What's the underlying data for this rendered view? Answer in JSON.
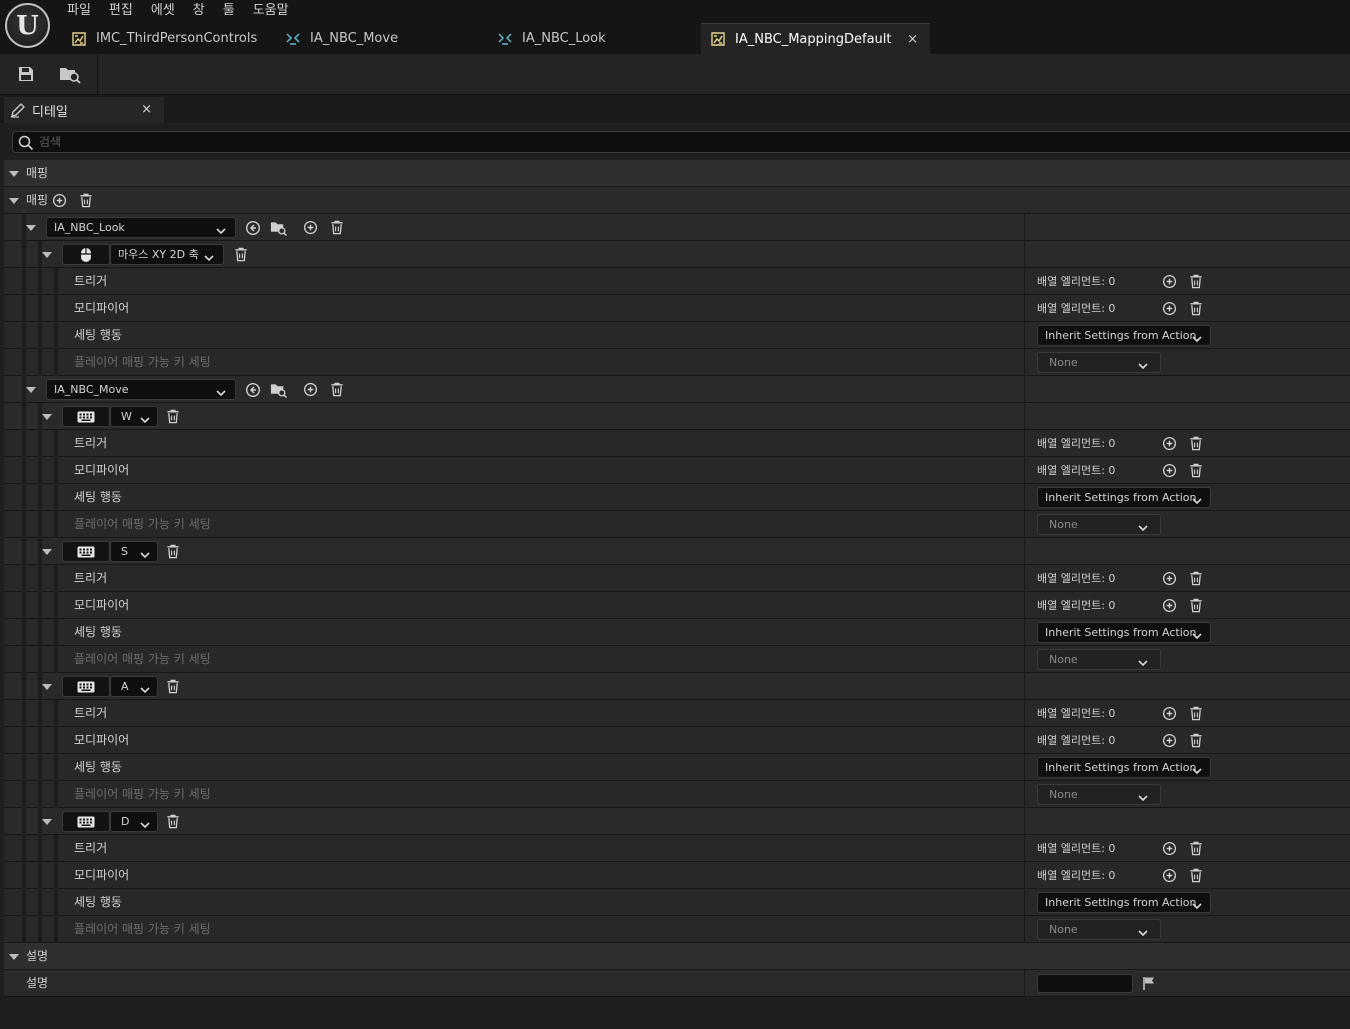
{
  "app": {
    "logo_letter": "U",
    "menu": [
      "파일",
      "편집",
      "에셋",
      "창",
      "툴",
      "도움말"
    ],
    "tabs": [
      {
        "label": "IMC_ThirdPersonControls",
        "icon": "input-mapping-context-icon"
      },
      {
        "label": "IA_NBC_Move",
        "icon": "input-action-icon"
      },
      {
        "label": "IA_NBC_Look",
        "icon": "input-action-icon"
      },
      {
        "label": "IA_NBC_MappingDefault",
        "icon": "input-mapping-context-icon",
        "active": true,
        "close": "×"
      }
    ]
  },
  "details": {
    "tab_label": "디테일",
    "tab_close": "×",
    "search_placeholder": "검색",
    "section_mapping": "매핑",
    "mappings_label": "매핑",
    "section_description": "설명",
    "description_label": "설명"
  },
  "labels": {
    "triggers": "트리거",
    "modifiers": "모디파이어",
    "setting_behavior": "세팅 행동",
    "player_mappable": "플레이어 매핑 가능 키 세팅",
    "array_elements": "배열 엘리먼트: 0",
    "inherit": "Inherit Settings from Action",
    "none": "None"
  },
  "actions": [
    {
      "name": "IA_NBC_Look",
      "keys": [
        {
          "key": "마우스 XY 2D 축",
          "device": "mouse-icon"
        }
      ]
    },
    {
      "name": "IA_NBC_Move",
      "keys": [
        {
          "key": "W",
          "device": "keyboard-icon"
        },
        {
          "key": "S",
          "device": "keyboard-icon"
        },
        {
          "key": "A",
          "device": "keyboard-icon"
        },
        {
          "key": "D",
          "device": "keyboard-icon"
        }
      ]
    }
  ],
  "colors": {
    "background": "#1a1a1a",
    "row": "#2a2a2a",
    "category_row": "#2f2f2f",
    "accent_input_action": "#5fb8c8",
    "accent_mapping_context": "#e6d38a"
  }
}
